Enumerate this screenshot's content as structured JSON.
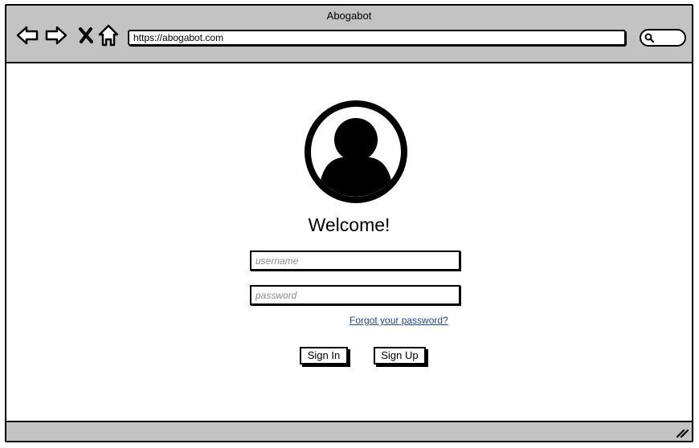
{
  "window": {
    "title": "Abogabot"
  },
  "toolbar": {
    "back_icon": "back-arrow-icon",
    "forward_icon": "forward-arrow-icon",
    "stop_icon": "close-x-icon",
    "home_icon": "home-icon",
    "url": "https://abogabot.com",
    "search_icon": "search-icon"
  },
  "login": {
    "avatar_icon": "user-avatar-icon",
    "welcome": "Welcome!",
    "username_placeholder": "username",
    "password_placeholder": "password",
    "forgot_link": "Forgot your password?",
    "sign_in_label": "Sign In",
    "sign_up_label": "Sign Up"
  },
  "statusbar": {
    "resize_icon": "resize-grip-icon"
  },
  "colors": {
    "chrome": "#c3c3c3",
    "border": "#000000",
    "link": "#1f4a8c",
    "placeholder": "#8a8a8a"
  }
}
